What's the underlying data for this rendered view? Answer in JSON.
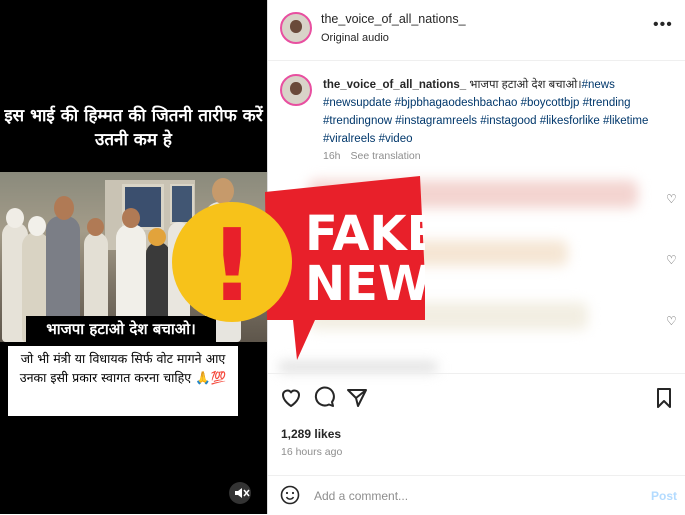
{
  "video": {
    "caption_top": "इस भाई की हिम्मत की जितनी तारीफ करें उतनी कम हे",
    "banner": "भाजपा हटाओ देश बचाओ।",
    "box_text": "जो भी मंत्री या विधायक सिर्फ वोट मागने आए उनका इसी प्रकार स्वागत करना चाहिए 🙏💯",
    "mute_icon": "speaker-muted-icon"
  },
  "header": {
    "username": "the_voice_of_all_nations_",
    "audio": "Original audio",
    "more_icon": "more-dots-icon"
  },
  "caption": {
    "username": "the_voice_of_all_nations_",
    "text": " भाजपा हटाओ देश बचाओ।",
    "hashtags": "#news #newsupdate #bjpbhagaodeshbachao #boycottbjp #trending #trendingnow #instagramreels #instagood #likesforlike #liketime #viralreels #video",
    "time": "16h",
    "see_translation": "See translation"
  },
  "stats": {
    "likes": "1,289 likes",
    "ago": "16 hours ago"
  },
  "comment": {
    "placeholder": "Add a comment...",
    "post_label": "Post"
  },
  "overlay": {
    "line1": "FAKE",
    "line2": "NEWS",
    "mark": "!",
    "accent": "#e8202a",
    "warn": "#f7c21a"
  }
}
